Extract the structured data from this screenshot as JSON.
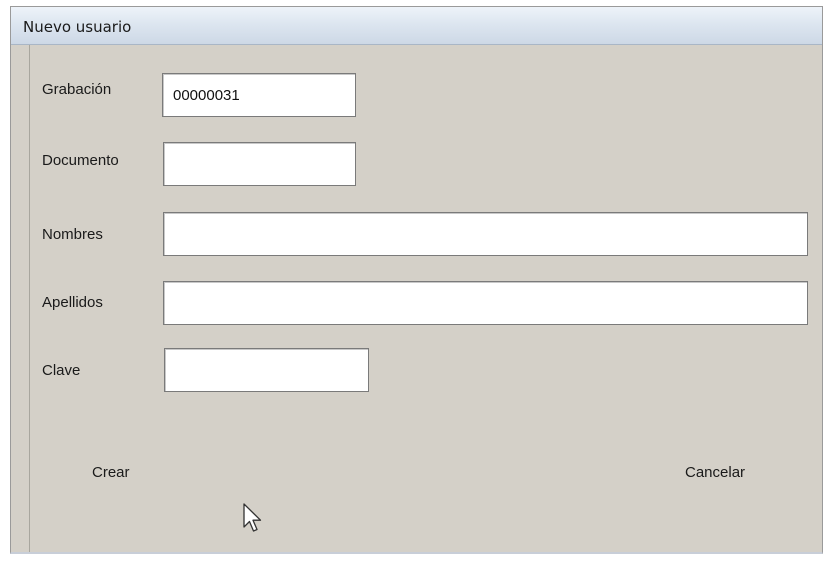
{
  "window": {
    "title": "Nuevo usuario"
  },
  "form": {
    "grabacion": {
      "label": "Grabación",
      "value": "00000031"
    },
    "documento": {
      "label": "Documento",
      "value": ""
    },
    "nombres": {
      "label": "Nombres",
      "value": ""
    },
    "apellidos": {
      "label": "Apellidos",
      "value": ""
    },
    "clave": {
      "label": "Clave",
      "value": ""
    }
  },
  "buttons": {
    "crear": "Crear",
    "cancelar": "Cancelar"
  },
  "colors": {
    "dialog_background": "#d4d0c8",
    "title_bar": "#dde6f0",
    "field_background": "#ffffff"
  },
  "icons": {
    "pointer": "mouse-pointer-icon"
  }
}
